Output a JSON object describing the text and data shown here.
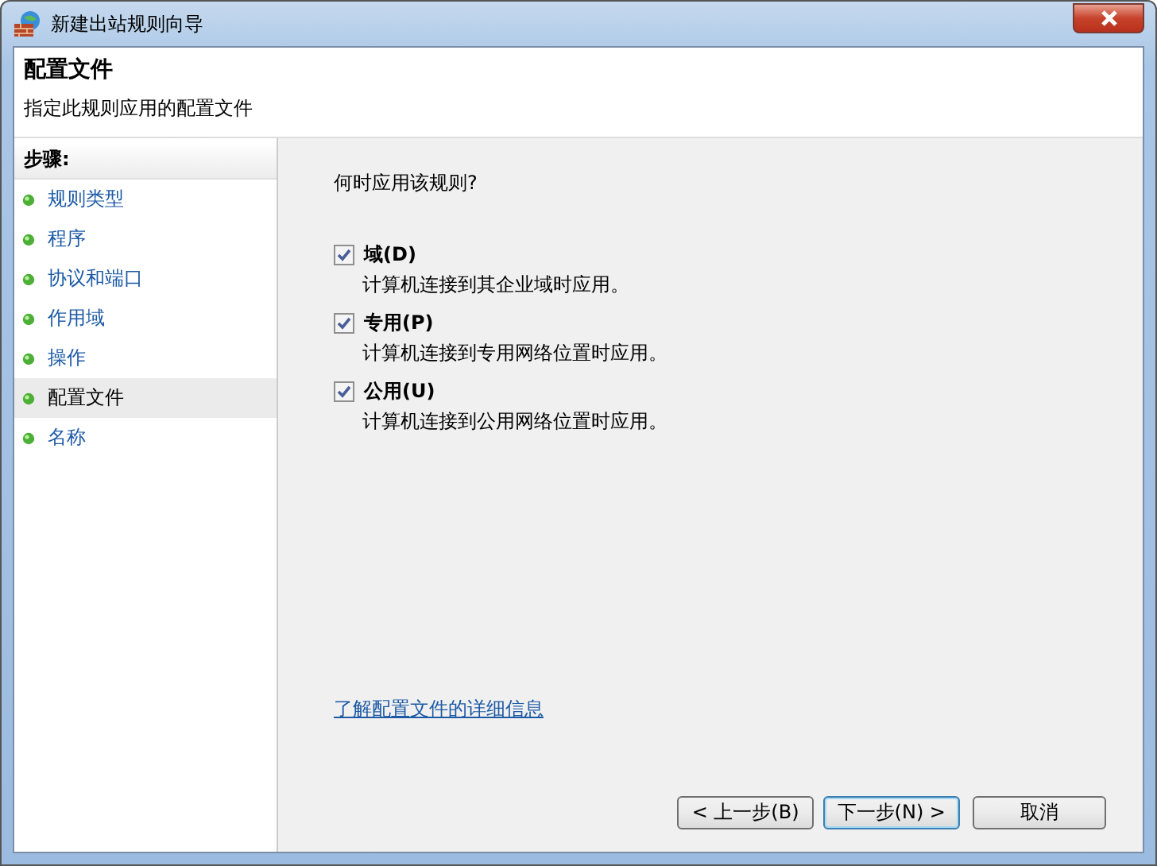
{
  "window": {
    "title": "新建出站规则向导"
  },
  "header": {
    "title": "配置文件",
    "subtitle": "指定此规则应用的配置文件"
  },
  "steps": {
    "heading": "步骤:",
    "items": [
      {
        "label": "规则类型",
        "selected": false
      },
      {
        "label": "程序",
        "selected": false
      },
      {
        "label": "协议和端口",
        "selected": false
      },
      {
        "label": "作用域",
        "selected": false
      },
      {
        "label": "操作",
        "selected": false
      },
      {
        "label": "配置文件",
        "selected": true
      },
      {
        "label": "名称",
        "selected": false
      }
    ]
  },
  "question": "何时应用该规则?",
  "options": [
    {
      "label": "域(D)",
      "description": "计算机连接到其企业域时应用。",
      "checked": true
    },
    {
      "label": "专用(P)",
      "description": "计算机连接到专用网络位置时应用。",
      "checked": true
    },
    {
      "label": "公用(U)",
      "description": "计算机连接到公用网络位置时应用。",
      "checked": true
    }
  ],
  "link": "了解配置文件的详细信息",
  "buttons": [
    {
      "label": "< 上一步(B)",
      "default": false
    },
    {
      "label": "下一步(N) >",
      "default": true
    },
    {
      "label": "取消",
      "default": false
    }
  ]
}
